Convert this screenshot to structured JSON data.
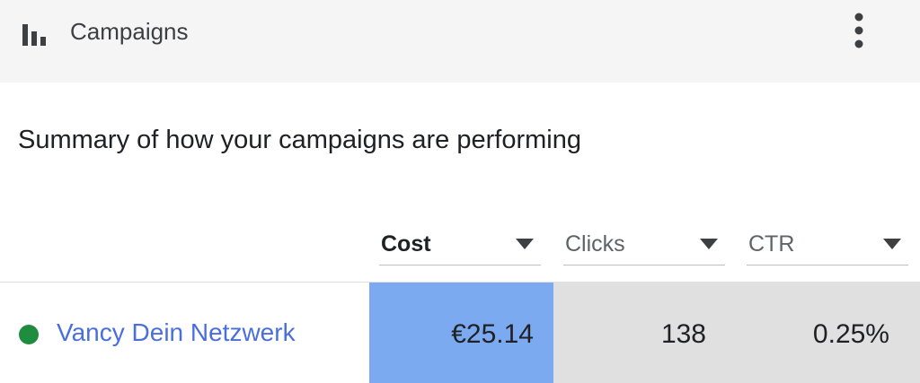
{
  "header": {
    "icon": "bar-chart-icon",
    "title": "Campaigns",
    "menu_icon": "more-vert-icon"
  },
  "summary_text": "Summary of how your campaigns are performing",
  "columns": [
    {
      "label": "Cost",
      "active": true,
      "icon": "dropdown-arrow-icon"
    },
    {
      "label": "Clicks",
      "active": false,
      "icon": "dropdown-arrow-icon"
    },
    {
      "label": "CTR",
      "active": false,
      "icon": "dropdown-arrow-icon"
    }
  ],
  "rows": [
    {
      "status_color": "#1e8e3e",
      "name": "Vancy Dein Netzwerk",
      "cost": "€25.14",
      "clicks": "138",
      "ctr": "0.25%"
    }
  ],
  "colors": {
    "link": "#4a6fdc",
    "active_column": "#7baaf0",
    "inactive_column": "#e0e0e0",
    "header_bg": "#f5f5f5"
  }
}
